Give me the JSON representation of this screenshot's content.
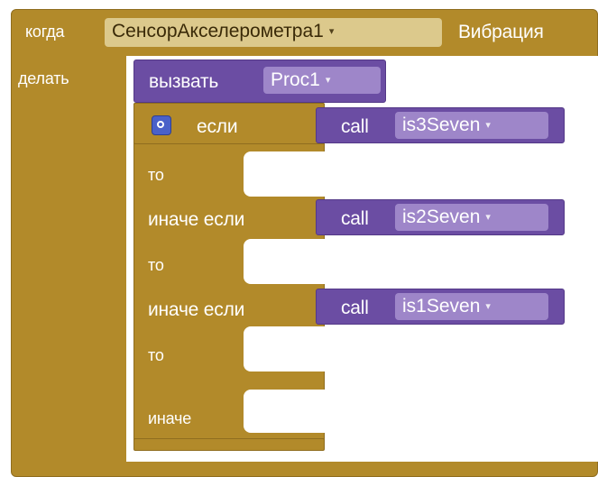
{
  "event_block": {
    "when_label": "когда",
    "component": "СенсорАкселерометра1",
    "event": "Вибрация",
    "do_label": "делать"
  },
  "call_block": {
    "call_label": "вызвать",
    "procedure": "Proc1"
  },
  "if_block": {
    "if_label": "если",
    "then_label_1": "то",
    "elseif_label_1": "иначе если",
    "then_label_2": "то",
    "elseif_label_2": "иначе если",
    "then_label_3": "то",
    "else_label": "иначе"
  },
  "conditions": [
    {
      "call_label": "call",
      "procedure": "is3Seven"
    },
    {
      "call_label": "call",
      "procedure": "is2Seven"
    },
    {
      "call_label": "call",
      "procedure": "is1Seven"
    }
  ],
  "colors": {
    "event_block": "#b28a2a",
    "procedure_block": "#6b4da3",
    "control_block": "#b28a2a",
    "mutator_icon": "#4a61c9"
  },
  "icons": {
    "dropdown": "▾",
    "mutator": "gear-icon"
  }
}
